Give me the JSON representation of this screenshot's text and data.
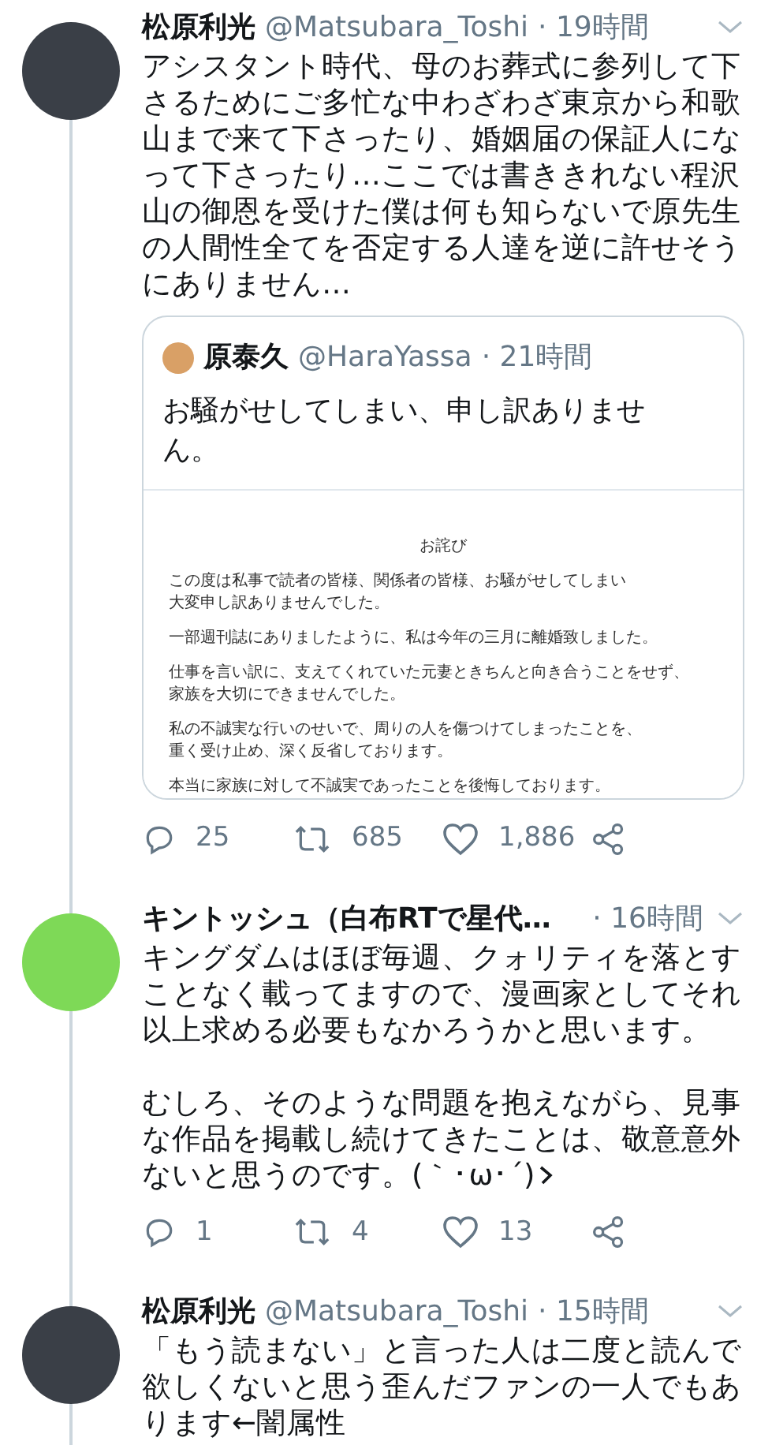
{
  "tweets": [
    {
      "name": "松原利光",
      "handle": "@Matsubara_Toshi",
      "time": "· 19時間",
      "color": "#3a3f47",
      "paragraphs": [
        "アシスタント時代、母のお葬式に参列して下さるためにご多忙な中わざわざ東京から和歌山まで来て下さったり、婚姻届の保証人になって下さったり…ここでは書ききれない程沢山の御恩を受けた僕は何も知らないで原先生の人間性全てを否定する人達を逆に許せそうにありません…"
      ],
      "quote": {
        "name": "原泰久",
        "handle": "@HaraYassa",
        "time": "· 21時間",
        "text": "お騒がせしてしまい、申し訳ありません。",
        "document": {
          "title": "お詫び",
          "paragraphs": [
            [
              "この度は私事で読者の皆様、関係者の皆様、お騒がせしてしまい",
              "大変申し訳ありませんでした。"
            ],
            [
              "一部週刊誌にありましたように、私は今年の三月に離婚致しました。"
            ],
            [
              "仕事を言い訳に、支えてくれていた元妻ときちんと向き合うことをせず、",
              "家族を大切にできませんでした。"
            ],
            [
              "私の不誠実な行いのせいで、周りの人を傷つけてしまったことを、",
              "重く受け止め、深く反省しております。"
            ],
            [
              "本当に家族に対して不誠実であったことを後悔しております。"
            ]
          ]
        }
      },
      "actions": {
        "replies": "25",
        "retweets": "685",
        "likes": "1,886"
      }
    },
    {
      "name": "キントッシュ（白布RTで星代…",
      "time": "· 16時間",
      "color": "#7ed957",
      "paragraphs": [
        "キングダムはほぼ毎週、クォリティを落とすことなく載ってますので、漫画家としてそれ以上求める必要もなかろうかと思います。",
        "むしろ、そのような問題を抱えながら、見事な作品を掲載し続けてきたことは、敬意意外ないと思うのです。(｀･ω･´)"
      ],
      "actions": {
        "replies": "1",
        "retweets": "4",
        "likes": "13"
      }
    },
    {
      "name": "松原利光",
      "handle": "@Matsubara_Toshi",
      "time": "· 15時間",
      "color": "#3a3f47",
      "paragraphs": [
        "「もう読まない」と言った人は二度と読んで欲しくないと思う歪んだファンの一人でもあります←闇属性"
      ]
    }
  ]
}
